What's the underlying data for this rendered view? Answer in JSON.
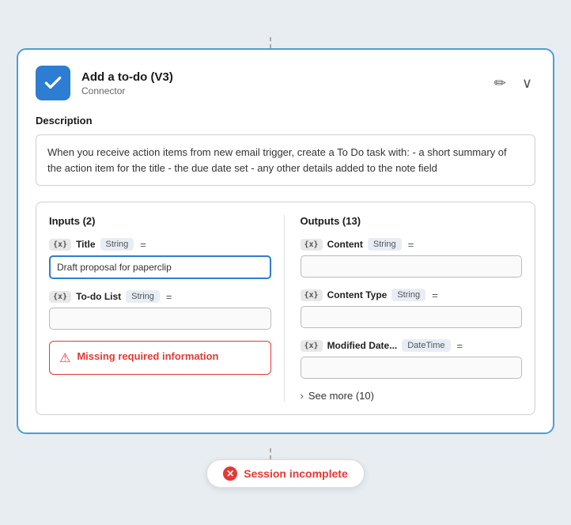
{
  "header": {
    "title": "Add a to-do (V3)",
    "subtitle": "Connector",
    "edit_icon": "✏",
    "expand_icon": "∨"
  },
  "description": {
    "label": "Description",
    "text": "When you receive action items from new email trigger, create a To Do task with: - a short summary of the action item for the title - the due date set - any other details added to the note field"
  },
  "inputs": {
    "col_title": "Inputs (2)",
    "fields": [
      {
        "badge": "{x}",
        "name": "Title",
        "type": "String",
        "eq": "=",
        "value": "Draft proposal for paperclip",
        "active": true,
        "empty": false
      },
      {
        "badge": "{x}",
        "name": "To-do List",
        "type": "String",
        "eq": "=",
        "value": "",
        "active": false,
        "empty": true
      }
    ],
    "error": {
      "text": "Missing required information"
    }
  },
  "outputs": {
    "col_title": "Outputs (13)",
    "fields": [
      {
        "badge": "{x}",
        "name": "Content",
        "type": "String",
        "eq": "=",
        "value": "",
        "empty": true
      },
      {
        "badge": "{x}",
        "name": "Content Type",
        "type": "String",
        "eq": "=",
        "value": "",
        "empty": true
      },
      {
        "badge": "{x}",
        "name": "Modified Date...",
        "type": "DateTime",
        "eq": "=",
        "value": "",
        "empty": true
      }
    ],
    "see_more": "See more (10)"
  },
  "session": {
    "text": "Session incomplete"
  }
}
